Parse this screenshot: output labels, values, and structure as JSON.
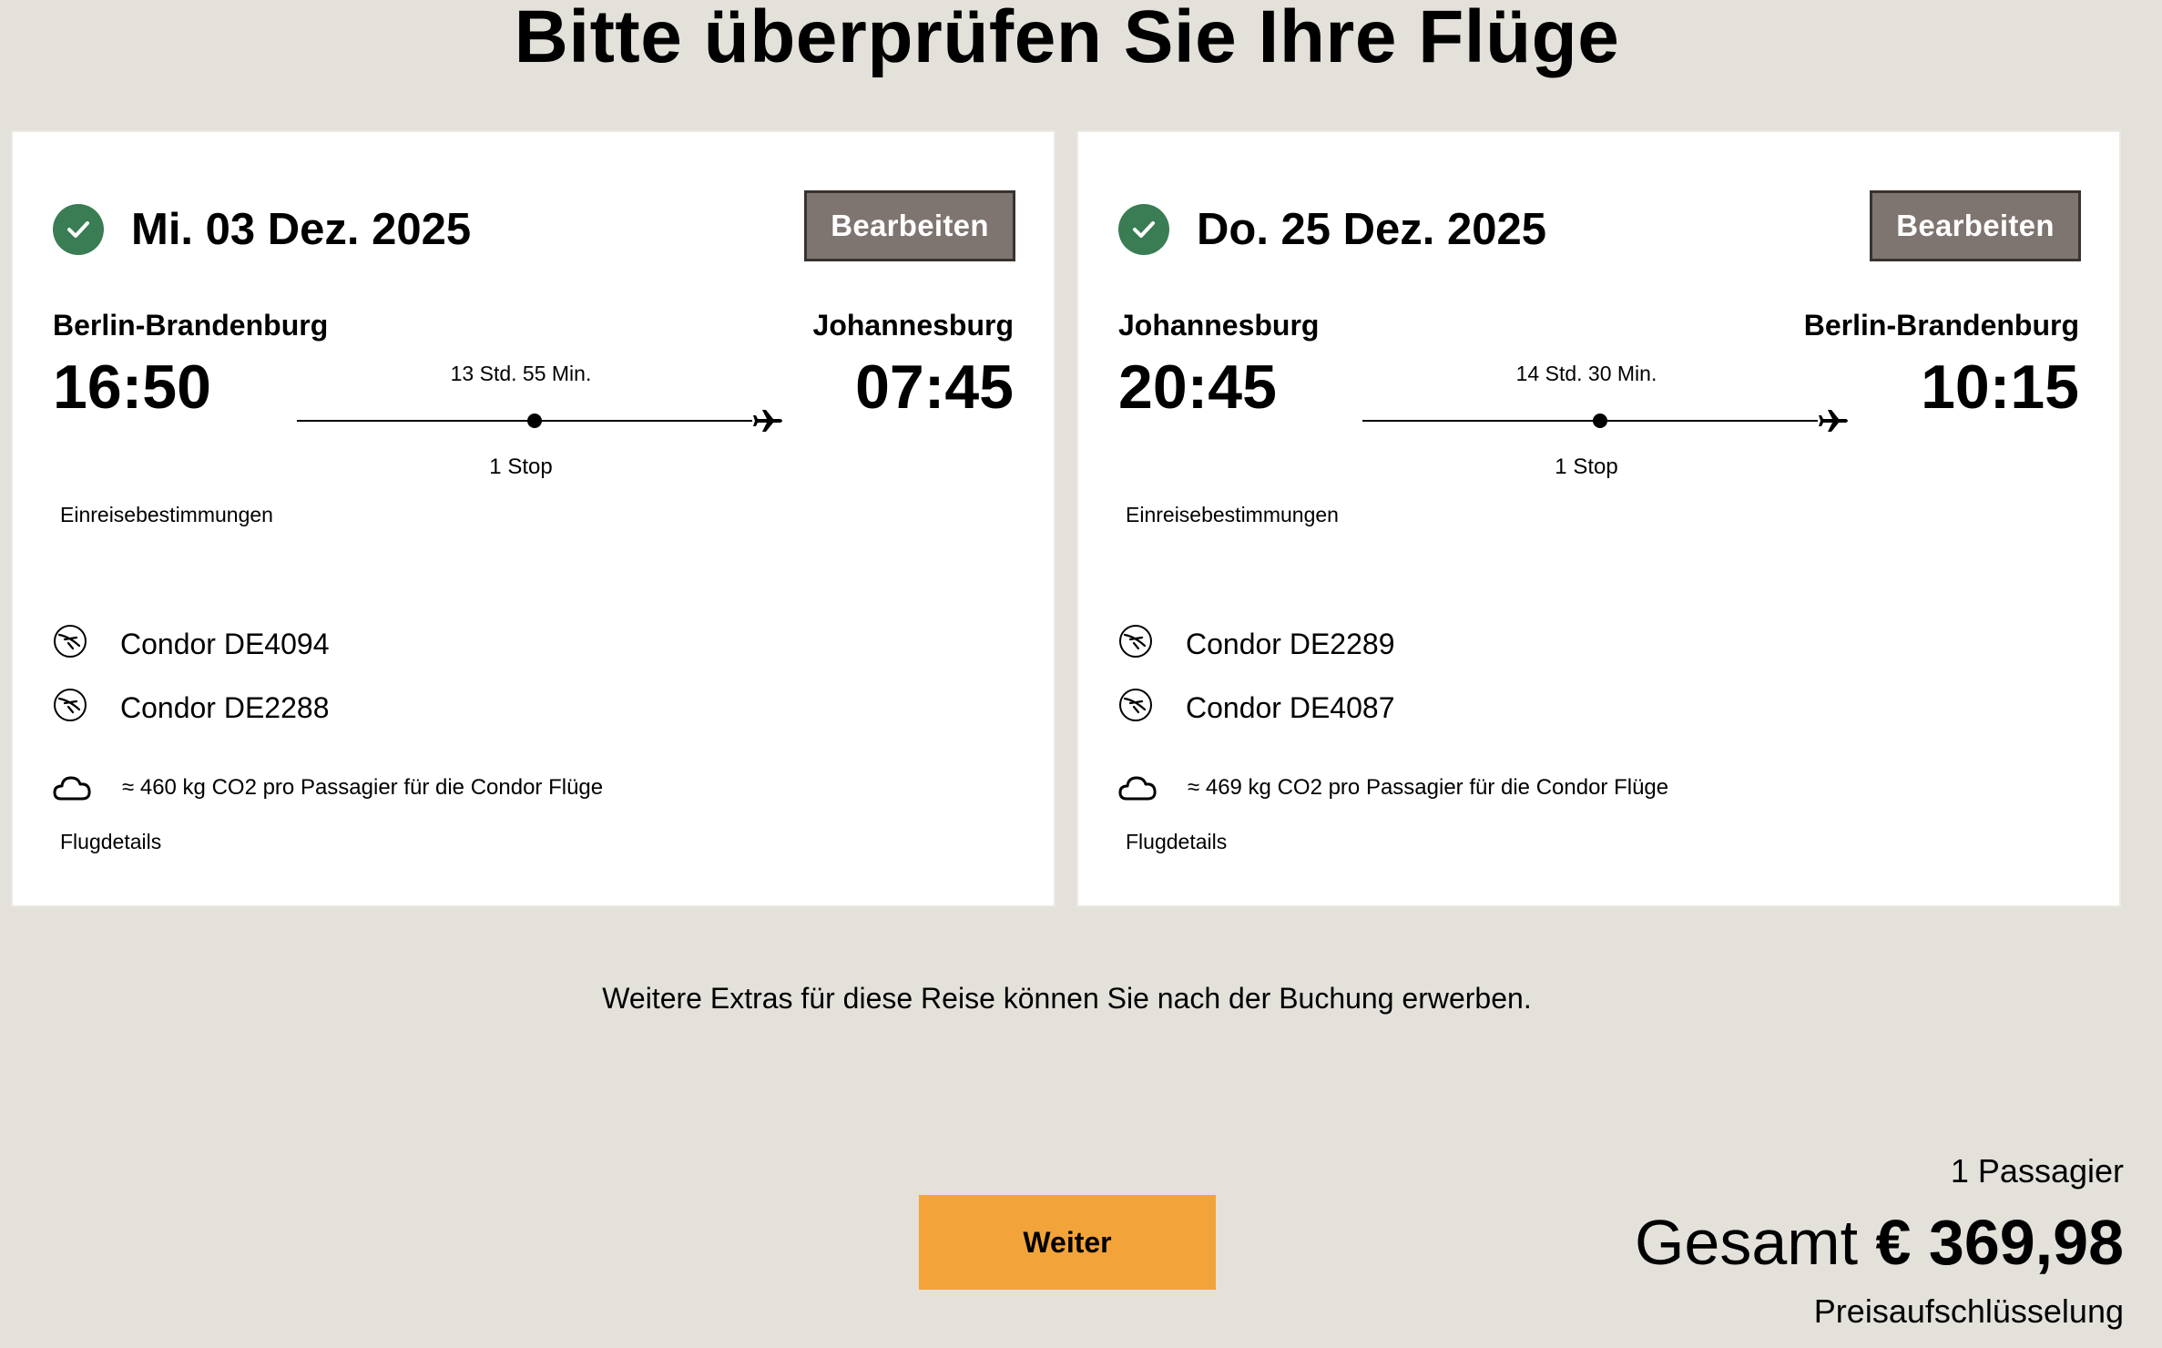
{
  "page": {
    "title": "Bitte überprüfen Sie Ihre Flüge"
  },
  "flights": [
    {
      "date": "Mi. 03 Dez. 2025",
      "edit_label": "Bearbeiten",
      "origin": "Berlin-Brandenburg",
      "destination": "Johannesburg",
      "departure_time": "16:50",
      "arrival_time": "07:45",
      "duration": "13 Std. 55 Min.",
      "stops": "1 Stop",
      "entry_requirements": "Einreisebestimmungen",
      "segments": [
        {
          "airline_icon": "condor-logo-icon",
          "label": "Condor DE4094"
        },
        {
          "airline_icon": "condor-logo-icon",
          "label": "Condor DE2288"
        }
      ],
      "co2": "≈ 460 kg CO2 pro Passagier für die Condor Flüge",
      "details_link": "Flugdetails"
    },
    {
      "date": "Do. 25 Dez. 2025",
      "edit_label": "Bearbeiten",
      "origin": "Johannesburg",
      "destination": "Berlin-Brandenburg",
      "departure_time": "20:45",
      "arrival_time": "10:15",
      "duration": "14 Std. 30 Min.",
      "stops": "1 Stop",
      "entry_requirements": "Einreisebestimmungen",
      "segments": [
        {
          "airline_icon": "condor-logo-icon",
          "label": "Condor DE2289"
        },
        {
          "airline_icon": "condor-logo-icon",
          "label": "Condor DE4087"
        }
      ],
      "co2": "≈ 469 kg CO2 pro Passagier für die Condor Flüge",
      "details_link": "Flugdetails"
    }
  ],
  "extras_note": "Weitere Extras für diese Reise können Sie nach der Buchung erwerben.",
  "footer": {
    "continue_label": "Weiter",
    "passengers": "1 Passagier",
    "total_label": "Gesamt",
    "total_amount": "€ 369,98",
    "price_breakdown": "Preisaufschlüsselung"
  },
  "colors": {
    "background": "#e4e1da",
    "check_green": "#3a7c54",
    "edit_button": "#7e7570",
    "continue_button": "#f2a43a"
  }
}
